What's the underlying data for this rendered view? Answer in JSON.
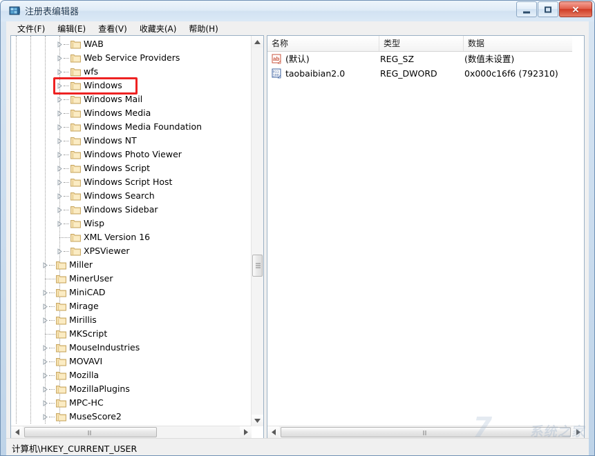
{
  "window": {
    "title": "注册表编辑器",
    "app_icon": "registry-editor-icon",
    "buttons": {
      "minimize": "—",
      "maximize": "□",
      "close": "✕"
    }
  },
  "menubar": {
    "items": [
      {
        "label": "文件(F)"
      },
      {
        "label": "编辑(E)"
      },
      {
        "label": "查看(V)"
      },
      {
        "label": "收藏夹(A)"
      },
      {
        "label": "帮助(H)"
      }
    ]
  },
  "tree": {
    "highlight": {
      "target_label": "Windows",
      "color": "#ee2222"
    },
    "items": [
      {
        "label": "WAB",
        "depth": 4,
        "expandable": true
      },
      {
        "label": "Web Service Providers",
        "depth": 4,
        "expandable": true
      },
      {
        "label": "wfs",
        "depth": 4,
        "expandable": true
      },
      {
        "label": "Windows",
        "depth": 4,
        "expandable": true,
        "highlighted": true
      },
      {
        "label": "Windows Mail",
        "depth": 4,
        "expandable": true
      },
      {
        "label": "Windows Media",
        "depth": 4,
        "expandable": true
      },
      {
        "label": "Windows Media Foundation",
        "depth": 4,
        "expandable": true
      },
      {
        "label": "Windows NT",
        "depth": 4,
        "expandable": true
      },
      {
        "label": "Windows Photo Viewer",
        "depth": 4,
        "expandable": true
      },
      {
        "label": "Windows Script",
        "depth": 4,
        "expandable": true
      },
      {
        "label": "Windows Script Host",
        "depth": 4,
        "expandable": true
      },
      {
        "label": "Windows Search",
        "depth": 4,
        "expandable": true
      },
      {
        "label": "Windows Sidebar",
        "depth": 4,
        "expandable": true
      },
      {
        "label": "Wisp",
        "depth": 4,
        "expandable": true
      },
      {
        "label": "XML Version 16",
        "depth": 4,
        "expandable": false
      },
      {
        "label": "XPSViewer",
        "depth": 4,
        "expandable": true
      },
      {
        "label": "Miller",
        "depth": 3,
        "expandable": true
      },
      {
        "label": "MinerUser",
        "depth": 3,
        "expandable": false
      },
      {
        "label": "MiniCAD",
        "depth": 3,
        "expandable": true
      },
      {
        "label": "Mirage",
        "depth": 3,
        "expandable": true
      },
      {
        "label": "Mirillis",
        "depth": 3,
        "expandable": true
      },
      {
        "label": "MKScript",
        "depth": 3,
        "expandable": false
      },
      {
        "label": "MouseIndustries",
        "depth": 3,
        "expandable": true
      },
      {
        "label": "MOVAVI",
        "depth": 3,
        "expandable": true
      },
      {
        "label": "Mozilla",
        "depth": 3,
        "expandable": true
      },
      {
        "label": "MozillaPlugins",
        "depth": 3,
        "expandable": true
      },
      {
        "label": "MPC-HC",
        "depth": 3,
        "expandable": true
      },
      {
        "label": "MuseScore2",
        "depth": 3,
        "expandable": true
      }
    ]
  },
  "values": {
    "columns": [
      {
        "label": "名称"
      },
      {
        "label": "类型"
      },
      {
        "label": "数据"
      }
    ],
    "rows": [
      {
        "name": "(默认)",
        "type": "REG_SZ",
        "data": "(数值未设置)",
        "icon": "string-value-icon"
      },
      {
        "name": "taobaibian2.0",
        "type": "REG_DWORD",
        "data": "0x000c16f6 (792310)",
        "icon": "dword-value-icon"
      }
    ]
  },
  "statusbar": {
    "path": "计算机\\HKEY_CURRENT_USER"
  },
  "watermark": {
    "text": "系统之家",
    "mark": "7"
  }
}
